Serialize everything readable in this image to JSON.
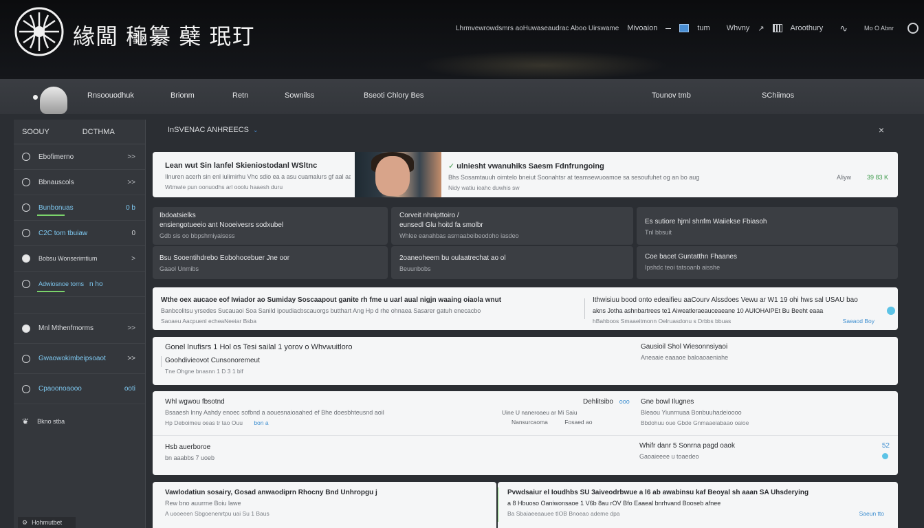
{
  "header": {
    "brand_title": "緣闆 龝纂 蘗 珉玎",
    "links": [
      "Lhrmvewrowdsmrs aoHuwaseaudrac Aboo Uirswame",
      "Mivoaion",
      "tum",
      "Whvny",
      "Aroothury",
      "Mo O Abnr"
    ],
    "colors": {
      "accent": "#7ec8f0",
      "green": "#7bd36b"
    }
  },
  "nav": {
    "items": [
      "Rnsoouodhuk",
      "Brionm",
      "Retn",
      "Sownilss",
      "Bseoti Chlory Bes",
      "Tounov tmb",
      "SChiimos"
    ]
  },
  "sidebar": {
    "head_left": "SOOUY",
    "head_right": "DCTHMA",
    "items": [
      {
        "label": "Ebofimerno",
        "chev": ">>",
        "icon": "circle-icon"
      },
      {
        "label": "Bbnauscols",
        "chev": ">>",
        "icon": "globe-icon"
      },
      {
        "label": "Bunbonuas",
        "chev": "0 b",
        "icon": "cloud-icon",
        "active": true
      },
      {
        "label": "C2C tom tbuiaw",
        "chev": "0",
        "icon": "circle-icon",
        "active": true
      },
      {
        "label": "Bobsu Wonserimtium",
        "chev": ">",
        "icon": "person-icon"
      },
      {
        "label": "Adwiosnoe toms",
        "chev": "n ho",
        "icon": "circle-icon",
        "active": true
      }
    ],
    "items2": [
      {
        "label": "Mnl Mthenfmorms",
        "chev": ">>",
        "icon": "dot-icon"
      },
      {
        "label": "Gwaowokimbeipsoaot",
        "chev": ">>",
        "icon": "globe-icon",
        "active": true
      },
      {
        "label": "Cpaoonoaooo",
        "chev": "ooti",
        "icon": "circle-icon",
        "active": true
      },
      {
        "label": "Bkno stba",
        "chev": "",
        "icon": "leaf-icon"
      }
    ],
    "footer": "Hohmutbet"
  },
  "content": {
    "heading": "InSVENAC ANHREECS",
    "hero": {
      "title": "Lean wut Sin lanfel Skieniostodanl WSltnc",
      "sub": "Ilnuren acerh sin enl iulimirhu Vhc sdio ea a asu cuamalurs gf aal aaiaay",
      "meta": "Wtmwie pun oonuodhs arl ooolu haaesh duru",
      "right_title": "ulniesht vwanuhiks Saesm Fdnfrungoing",
      "right_sub": "Bhs Sosamtauuh oimtelo bneiut Soonahtsr at teamsewuoamoe sa sesoufuhet og an bo aug",
      "right_meta": "Nidy watiu ieahc duwhis sw",
      "right_tag": "Aliyw",
      "right_count": "39 83 K"
    },
    "grid": [
      {
        "title": "Ibdoatsielks",
        "title2": "ensiengotueeio ant Nooeivesrs sodxubel",
        "sub": "Gdb sis oo bbpshmiyaisess"
      },
      {
        "title": "Corveit nhnipttoiro /",
        "title2": "eunsedl Glu hoitd fa smolbr",
        "sub": "Whlee eanahbas asrnaabeibeodoho iasdeo"
      },
      {
        "title": "Es sutiore hjrnl shnfm Waiiekse Fbiasoh",
        "title2": "",
        "sub": "Tnl bbsuit"
      },
      {
        "title": "Bsu Sooentihdrebo Eobohocebuer Jne oor",
        "title2": "",
        "sub": "Gaaol Unmibs"
      },
      {
        "title": "2oaneoheem bu oulaatrechat ao ol",
        "title2": "",
        "sub": "Beuunbobs"
      },
      {
        "title": "Coe bacet Guntatthn Fhaanes",
        "title2": "",
        "sub": "Ipshdc teoi tatsoanb aisshe"
      }
    ],
    "row1": {
      "left_title": "Wthe oex aucaoe eof Iwiador ao Sumiday Soscaapout ganite rh   fme u uarl aual nigjn waaing oiaola wnut",
      "left_sub": "Banbcolitsu yrsedes Sucauaoi Soa Sanild ipoudiacbscauorgs butthart Ang Hp d rhe ohnaea Sasarer gatuh enecacbo",
      "left_meta": "Saoaeu Aacpuenl echeaNeeiar Bsba",
      "right_title": "Ithwisiuu bood onto edeaifieu aaCourv Alssdoes Vewu ar W1 19 ohi hws sal USAU bao",
      "right_sub": "akns Jotha ashnbartrees te1 Aiweatleraeauceaeane 10 AUIOHAIPEt Bu Beeht eaaa",
      "right_meta": "hBahboos Smaaeitmonn Oelruasdonu s Drbbs bbuas",
      "right_tag": "Saeaod Boy"
    },
    "row2": {
      "title": "Gonel lnufisrs 1 Hol os Tesi sailal 1 yorov o Whvwuitloro",
      "sub": "Goohdivieovot Cunsonoremeut",
      "meta": "Tne Ohgne bnasnn 1 D 3 1 blf",
      "right_title": "Gausioil Shol Wiesonnsiyaoi",
      "right_sub": "Aneaaie eaaaoe baloaoaeniahe"
    },
    "row3": {
      "title": "Whl wgwou fbsotnd",
      "sub": "Bsaaesh lnny Aahdy enoec sofbnd a aouesnaioaahed ef Bhe doesbhteusnd aoil",
      "meta": "Hp Deboimeu oeas tr tao Ouu",
      "meta_tag": "bon a",
      "mid_a": "Uine U naneroaeu ar  Mi Saiu",
      "mid_b": "Nansurcaoma",
      "mid_c": "Fosaed ao",
      "right_label": "Dehlitsibo",
      "right_tag": "ooo",
      "right_title": "Gne bowl Ilugnes",
      "right_sub": "Bleaou Yiunrnuaa Bonbuuhadeioooo",
      "right_meta": "Bbdohuu oue Gbde Gnmaaeiabaao oaioe",
      "title2": "Hsb auerboroe",
      "sub2": "bn aaabbs 7 uoeb",
      "right_title2": "Whifr danr 5 Sonrna pagd oaok",
      "right_sub2": "Gaoaieeee u toaedeo",
      "right_count2": "52"
    },
    "row4": {
      "left_title": "Vawlodatiun sosairy, Gosad anwaodiprn Rhocny Bnd Unhropgu j",
      "left_sub": "Rew bno auurrne Boiu lawe",
      "left_meta": "A uooeeen Sbgoenenrtpu uai Su 1 Baus",
      "right_title": "Pvwdsaiur el Ioudhbs SU 3aiveodrbwue a l6 ab awabinsu kaf Beoyal sh aaan  SA Uhsderying",
      "right_sub": "a 8 Hbuoso Oaniwonsaoe  1 V6b 8au rOV Bfo Eaaeal bnrhvand Booseb afnee",
      "right_meta": "Ba Sbaiaeeaauee    tIOB Bnoeao ademe dpa",
      "right_tag": "Saeun tto"
    }
  }
}
